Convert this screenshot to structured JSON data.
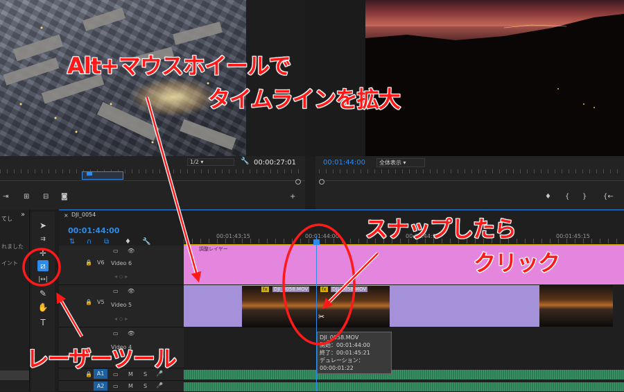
{
  "source_monitor": {
    "zoom_select": "1/2",
    "timecode": "00:00:27:01"
  },
  "program_monitor": {
    "timecode": "00:01:44:00",
    "zoom_select": "全体表示"
  },
  "project_panel": {
    "tab_fragment": "てし",
    "text_1": "れました",
    "text_2": "イント"
  },
  "sequence": {
    "tab_label": "DJI_0054",
    "timecode": "00:01:44:00",
    "ruler_labels": [
      "00:01:43:15",
      "00:01:44:00",
      "00:01:44:15",
      "00:01:45:15"
    ]
  },
  "tracks": [
    {
      "id": "V6",
      "name": "Video 6"
    },
    {
      "id": "V5",
      "name": "Video 5"
    },
    {
      "id": "V4",
      "name": "Video 4"
    },
    {
      "id": "A1",
      "name": "A1"
    },
    {
      "id": "A2",
      "name": "A2"
    }
  ],
  "clips": {
    "adjustment_layer": "調整レイヤー",
    "clip_left": "DJI_0058.MOV",
    "clip_right": "DJI_0058.MOV",
    "fx_badge": "fx"
  },
  "tooltip": {
    "title": "DJI_0058.MOV",
    "line_start": "開始：00:01:44:00",
    "line_end": "終了：00:01:45:21",
    "line_duration": "デュレーション：00:00:01:22"
  },
  "audio_track_buttons": {
    "mute": "M",
    "solo": "S"
  },
  "annotations": {
    "zoom_line1": "Alt+マウスホイールで",
    "zoom_line2": "タイムラインを拡大",
    "snap_line1": "スナップしたら",
    "snap_line2": "クリック",
    "razor_label": "レーザーツール"
  },
  "colors": {
    "annotation_red": "#ff1a1a",
    "playhead_blue": "#2d8ceb",
    "adjustment_pink": "#e486de",
    "clip_lavender": "#a590da",
    "audio_green": "#2e7a55"
  }
}
